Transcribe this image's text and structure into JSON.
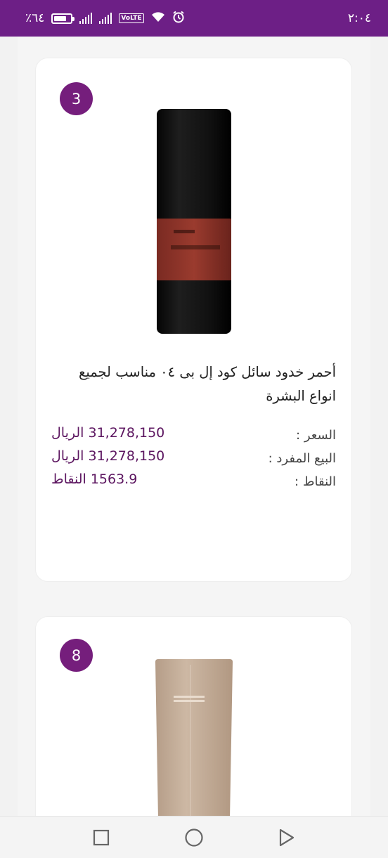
{
  "status_bar": {
    "battery_percent": "٪٦٤",
    "battery_level": 0.64,
    "time": "٢:٠٤",
    "icons": [
      "signal-icon",
      "signal-icon",
      "volte-icon",
      "wifi-icon",
      "alarm-icon"
    ],
    "volte_label": "VoLTE"
  },
  "colors": {
    "brand": "#6d1f86",
    "badge": "#751e7c",
    "price_text": "#5c1660"
  },
  "products": [
    {
      "rank": "3",
      "title": "أحمر خدود سائل كود إل بى ٠٤ مناسب لجميع انواع البشرة",
      "price_label": "السعر :",
      "price_value": "31,278,150",
      "price_unit": "الريال",
      "retail_label": "البيع المفرد :",
      "retail_value": "31,278,150",
      "retail_unit": "الريال",
      "points_label": "النقاط :",
      "points_value": "1563.9",
      "points_unit": "النقاط"
    },
    {
      "rank": "8"
    }
  ],
  "nav_bar": {
    "items": [
      "recents-icon",
      "home-icon",
      "back-icon"
    ]
  }
}
